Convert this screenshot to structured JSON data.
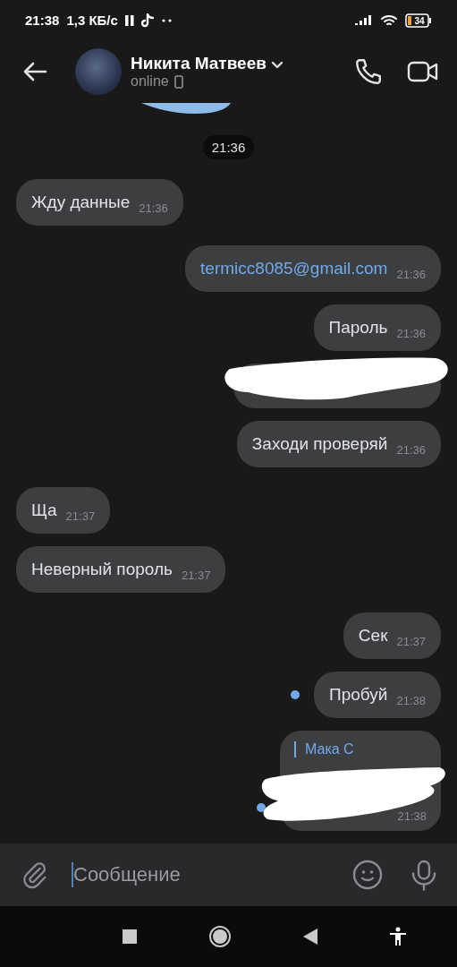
{
  "status_bar": {
    "time": "21:38",
    "speed": "1,3 КБ/с",
    "battery": "34"
  },
  "header": {
    "name": "Никита Матвеев",
    "status": "online"
  },
  "messages": [
    {
      "kind": "sticker"
    },
    {
      "kind": "date",
      "text": "21:36"
    },
    {
      "kind": "in",
      "text": "Жду данные",
      "time": "21:36",
      "unread": false,
      "redacted": false
    },
    {
      "kind": "out",
      "text": "termicc8085@gmail.com",
      "link": true,
      "time": "21:36",
      "unread": false,
      "redacted": false
    },
    {
      "kind": "out",
      "text": "Пароль",
      "time": "21:36",
      "unread": false,
      "redacted": false
    },
    {
      "kind": "out",
      "unread": false,
      "redacted": true
    },
    {
      "kind": "out",
      "text": "Заходи проверяй",
      "time": "21:36",
      "unread": false,
      "redacted": false
    },
    {
      "kind": "in",
      "text": "Ща",
      "time": "21:37",
      "unread": false,
      "redacted": false
    },
    {
      "kind": "in",
      "text": "Неверный пороль",
      "time": "21:37",
      "unread": false,
      "redacted": false
    },
    {
      "kind": "out",
      "text": "Сек",
      "time": "21:37",
      "unread": false,
      "redacted": false
    },
    {
      "kind": "out",
      "text": "Пробуй",
      "time": "21:38",
      "unread": true,
      "redacted": false
    },
    {
      "kind": "out",
      "quote": "Мака С",
      "time": "21:38",
      "unread": true,
      "redacted": true
    }
  ],
  "composer": {
    "placeholder": "Сообщение"
  }
}
